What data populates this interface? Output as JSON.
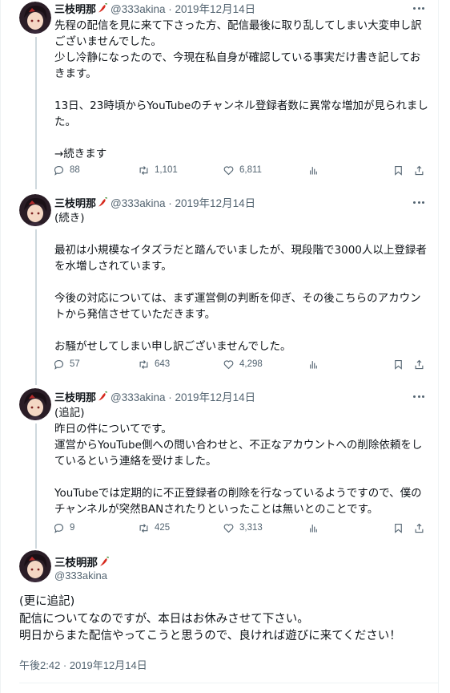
{
  "author": {
    "name": "三枝明那",
    "handle": "@333akina"
  },
  "tweets": [
    {
      "meta": "@333akina · 2019年12月14日",
      "lines": [
        "先程の配信を見に来て下さった方、配信最後に取り乱してしまい大変申し訳",
        "ございませんでした。",
        "少し冷静になったので、今現在私自身が確認している事実だけ書き記してお",
        "きます。",
        "",
        "13日、23時頃からYouTubeのチャンネル登録者数に異常な増加が見られまし",
        "た。",
        "",
        "→続きます"
      ],
      "replies": "88",
      "retweets": "1,101",
      "likes": "6,811"
    },
    {
      "meta": "@333akina · 2019年12月14日",
      "lines": [
        "(続き)",
        "",
        "最初は小規模なイタズラだと踏んでいましたが、現段階で3000人以上登録者",
        "を水増しされています。",
        "",
        "今後の対応については、まず運営側の判断を仰ぎ、その後こちらのアカウン",
        "トから発信させていただきます。",
        "",
        "お騒がせしてしまい申し訳ございませんでした。"
      ],
      "replies": "57",
      "retweets": "643",
      "likes": "4,298"
    },
    {
      "meta": "@333akina · 2019年12月14日",
      "lines": [
        "(追記)",
        "昨日の件についてです。",
        "運営からYouTube側への問い合わせと、不正なアカウントへの削除依頼をし",
        "ているという連絡を受けました。",
        "",
        "YouTubeでは定期的に不正登録者の削除を行なっているようですので、僕の",
        "チャンネルが突然BANされたりといったことは無いとのことです。"
      ],
      "replies": "9",
      "retweets": "425",
      "likes": "3,313"
    }
  ],
  "main_tweet": {
    "lines": [
      "(更に追記)",
      "配信についてなのですが、本日はお休みさせて下さい。",
      "明日からまた配信やってこうと思うので、良ければ遊びに来てください！"
    ],
    "timestamp": "午後2:42 · 2019年12月14日"
  },
  "icons": {
    "name_badge": "chili-pepper-icon",
    "more": "more-options-icon",
    "reply": "reply-icon",
    "retweet": "retweet-icon",
    "like": "heart-icon",
    "views": "analytics-icon",
    "bookmark": "bookmark-icon",
    "share": "share-icon"
  },
  "colors": {
    "text": "#0f1419",
    "secondary": "#536471",
    "thread_line": "#cfd9de",
    "pepper": "#d62a1e"
  }
}
